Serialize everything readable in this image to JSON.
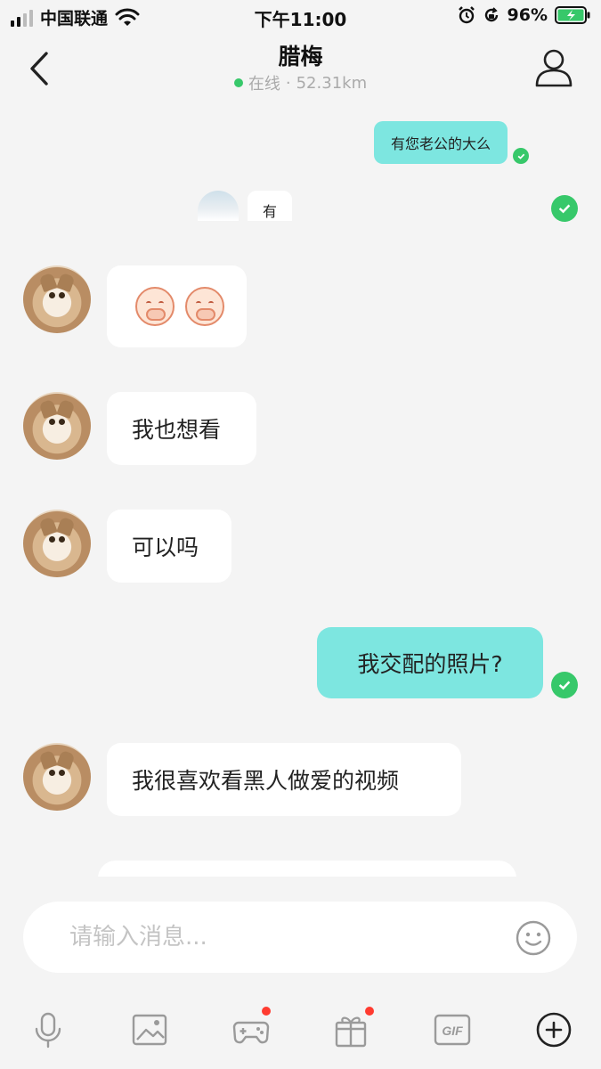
{
  "status_bar": {
    "carrier": "中国联通",
    "time": "下午11:00",
    "battery": "96%"
  },
  "header": {
    "title": "腊梅",
    "status": "在线",
    "separator": "·",
    "distance": "52.31km"
  },
  "messages": [
    {
      "id": "m1",
      "side": "out",
      "text": "有您老公的大么",
      "read": true
    },
    {
      "id": "m2",
      "side": "quote",
      "text": "有"
    },
    {
      "id": "m3",
      "side": "in",
      "type": "emoji",
      "emojis": [
        "covering-mouth-face",
        "covering-mouth-face"
      ]
    },
    {
      "id": "m4",
      "side": "in",
      "text": "我也想看"
    },
    {
      "id": "m5",
      "side": "in",
      "text": "可以吗"
    },
    {
      "id": "m6",
      "side": "out",
      "text": "我交配的照片?",
      "read": true
    },
    {
      "id": "m7",
      "side": "in",
      "text": "我很喜欢看黑人做爱的视频"
    }
  ],
  "input": {
    "placeholder": "请输入消息..."
  },
  "toolbar": [
    {
      "icon": "microphone-icon"
    },
    {
      "icon": "image-icon"
    },
    {
      "icon": "game-controller-icon",
      "badge": true
    },
    {
      "icon": "gift-icon",
      "badge": true
    },
    {
      "icon": "gif-icon",
      "label": "GIF"
    },
    {
      "icon": "plus-circle-icon"
    }
  ],
  "colors": {
    "outgoing_bubble": "#7de6e0",
    "incoming_bubble": "#ffffff",
    "online": "#37c86a",
    "badge": "#ff3b30",
    "background": "#f4f4f4"
  }
}
